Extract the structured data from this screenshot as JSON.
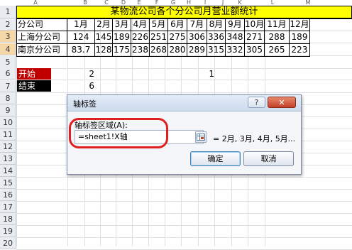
{
  "columns": [
    "A",
    "B",
    "C",
    "D",
    "E",
    "F",
    "G",
    "H",
    "I",
    "J",
    "K",
    "L",
    "M"
  ],
  "rows": [
    "1",
    "2",
    "3",
    "4",
    "5",
    "6",
    "7",
    "8",
    "9",
    "10",
    "11",
    "12",
    "13",
    "14",
    "15",
    "16",
    "17",
    "18",
    "19",
    "20"
  ],
  "title": "某物流公司各个分公司月营业额统计",
  "header_row": {
    "label": "分公司",
    "months": [
      "1月",
      "2月",
      "3月",
      "4月",
      "5月",
      "6月",
      "7月",
      "8月",
      "9月",
      "10月",
      "11月",
      "12月"
    ]
  },
  "data_rows": [
    {
      "label": "上海分公司",
      "values": [
        "124",
        "145",
        "189",
        "226",
        "251",
        "275",
        "306",
        "336",
        "348",
        "271",
        "288",
        "189"
      ]
    },
    {
      "label": "南京分公司",
      "values": [
        "83.7",
        "128",
        "175",
        "238",
        "268",
        "280",
        "289",
        "315",
        "332",
        "305",
        "265",
        "223"
      ]
    }
  ],
  "controls": {
    "start_label": "开始",
    "start_value": "2",
    "end_label": "结束",
    "end_value": "6",
    "h6_value": "1",
    "start_color": "#c00000",
    "end_color": "#000000"
  },
  "dialog": {
    "title": "轴标签",
    "help": "?",
    "close": "✕",
    "range_label": "轴标签区域(A):",
    "range_value": "=sheet1!X轴",
    "preview": "= 2月, 3月, 4月, 5月...",
    "ok": "确定",
    "cancel": "取消"
  }
}
